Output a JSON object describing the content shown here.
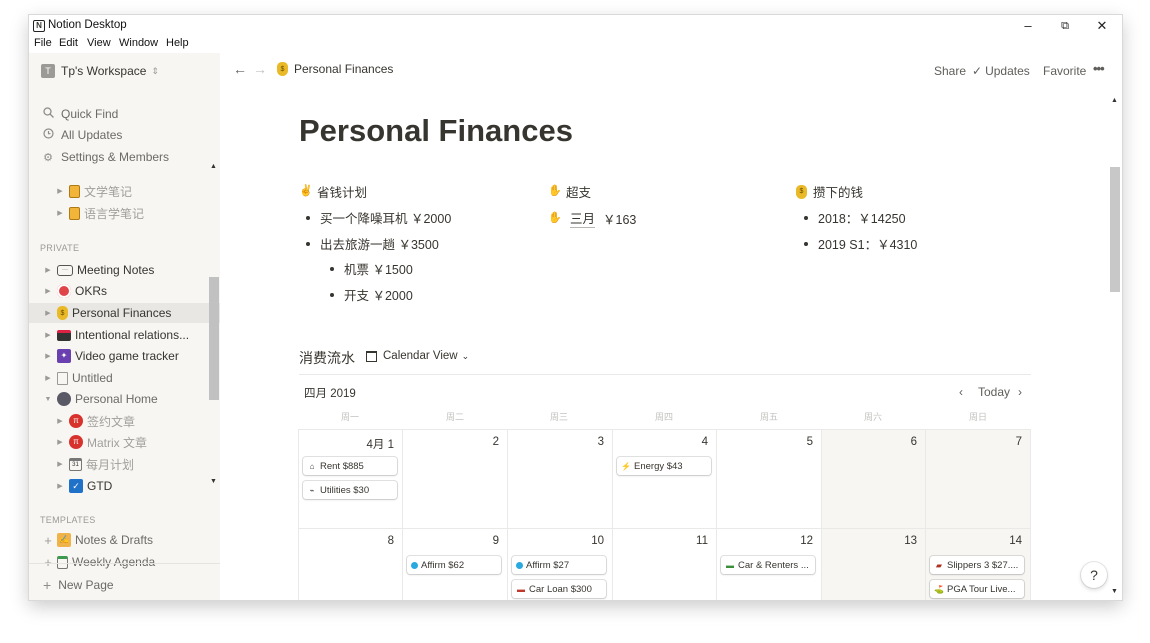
{
  "window": {
    "title": "Notion Desktop",
    "logo": "N",
    "controls": {
      "minimize": "–",
      "maximize": "⧉",
      "close": "✕"
    }
  },
  "menu": [
    "File",
    "Edit",
    "View",
    "Window",
    "Help"
  ],
  "sidebar": {
    "workspace": {
      "avatar": "T",
      "name": "Tp's Workspace",
      "chevron": "⌃⌄"
    },
    "links": [
      {
        "label": "Quick Find",
        "icon": "search-icon"
      },
      {
        "label": "All Updates",
        "icon": "clock-icon"
      },
      {
        "label": "Settings & Members",
        "icon": "gear-icon"
      }
    ],
    "tree_top": [
      {
        "label": "文学笔记",
        "icon": "notebook-icon"
      },
      {
        "label": "语言学笔记",
        "icon": "notebook-icon"
      }
    ],
    "private_label": "PRIVATE",
    "private": [
      {
        "label": "Meeting Notes",
        "icon": "speech-bubble-icon"
      },
      {
        "label": "OKRs",
        "icon": "target-icon"
      },
      {
        "label": "Personal Finances",
        "icon": "money-bag-icon"
      },
      {
        "label": "Intentional relations...",
        "icon": "clapper-icon"
      },
      {
        "label": "Video game tracker",
        "icon": "alien-monster-icon"
      },
      {
        "label": "Untitled",
        "icon": "page-icon"
      },
      {
        "label": "Personal Home",
        "icon": "globe-icon"
      },
      {
        "label": "签约文章",
        "icon": "pi-icon"
      },
      {
        "label": "Matrix 文章",
        "icon": "pi-icon"
      },
      {
        "label": "每月计划",
        "icon": "calendar-icon"
      },
      {
        "label": "GTD",
        "icon": "checkbox-icon"
      }
    ],
    "templates_label": "TEMPLATES",
    "templates": [
      {
        "label": "Notes & Drafts",
        "icon": "writing-hand-icon"
      },
      {
        "label": "Weekly Agenda",
        "icon": "clipboard-icon"
      }
    ],
    "new_page": "New Page"
  },
  "topbar": {
    "breadcrumb": "Personal Finances",
    "share": "Share",
    "updates": "Updates",
    "favorite": "Favorite",
    "more": "•••"
  },
  "page": {
    "title": "Personal Finances",
    "columns": [
      {
        "heading": "省钱计划",
        "items": [
          "买一个降噪耳机 ￥2000",
          "出去旅游一趟 ￥3500"
        ],
        "sub_items": [
          "机票 ￥1500",
          "开支 ￥2000"
        ]
      },
      {
        "heading": "超支",
        "link": "三月",
        "amount": "￥163"
      },
      {
        "heading": "攒下的钱",
        "items": [
          "2018：￥14250",
          "2019 S1：￥4310"
        ]
      }
    ]
  },
  "database": {
    "title": "消费流水",
    "view": "Calendar View",
    "month": "四月 2019",
    "today": "Today",
    "weekdays": [
      "周一",
      "周二",
      "周三",
      "周四",
      "周五",
      "周六",
      "周日"
    ],
    "week1": {
      "days": [
        "4月 1",
        "2",
        "3",
        "4",
        "5",
        "6",
        "7"
      ],
      "events": [
        {
          "label": "Rent $885"
        },
        {
          "label": "Utilities $30"
        },
        {
          "label": "Energy $43"
        }
      ]
    },
    "week2": {
      "days": [
        "8",
        "9",
        "10",
        "11",
        "12",
        "13",
        "14"
      ],
      "events": [
        {
          "label": "Affirm $62"
        },
        {
          "label": "Affirm $27"
        },
        {
          "label": "Car Loan $300"
        },
        {
          "label": "Car & Renters ..."
        },
        {
          "label": "Slippers 3 $27...."
        },
        {
          "label": "PGA Tour Live..."
        }
      ]
    }
  },
  "help": "?"
}
